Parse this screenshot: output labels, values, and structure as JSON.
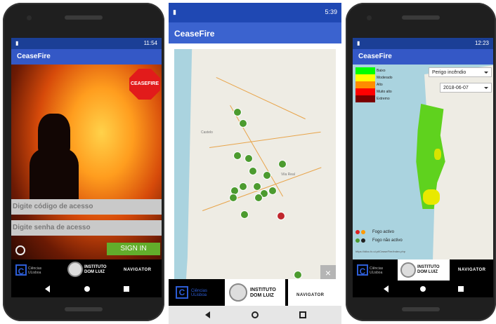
{
  "phone1": {
    "status_time": "11:54",
    "app_title": "CeaseFire",
    "stop_sign_text": "CEASEFIRE",
    "access_code_placeholder": "Digite código de acesso",
    "password_placeholder": "Digite senha de acesso",
    "sign_in_label": "SIGN IN"
  },
  "phone2": {
    "status_time": "5:39",
    "app_title": "CeaseFire",
    "close_label": "×",
    "place_labels": [
      "Vila Real",
      "Castelo"
    ]
  },
  "phone3": {
    "status_time": "12:23",
    "app_title": "CeaseFire",
    "legend": [
      {
        "label": "Baixo",
        "color": "#00ff00"
      },
      {
        "label": "Moderado",
        "color": "#ffff00"
      },
      {
        "label": "Alto",
        "color": "#ff8c00"
      },
      {
        "label": "Muito alto",
        "color": "#ff0000"
      },
      {
        "label": "Extremo",
        "color": "#7a0000"
      }
    ],
    "danger_select": "Perigo incêndio",
    "date_select": "2018-06-07",
    "fire_active": "Fogo activo",
    "fire_inactive": "Fogo não activo",
    "url": "https://idlcc.fc.ul.pt/CeaseFire/index.php"
  },
  "logos": {
    "ciencias": "Ciências ULisboa",
    "idl_line1": "INSTITUTO",
    "idl_line2": "DOM LUIZ",
    "navigator": "NAVIGATOR"
  }
}
